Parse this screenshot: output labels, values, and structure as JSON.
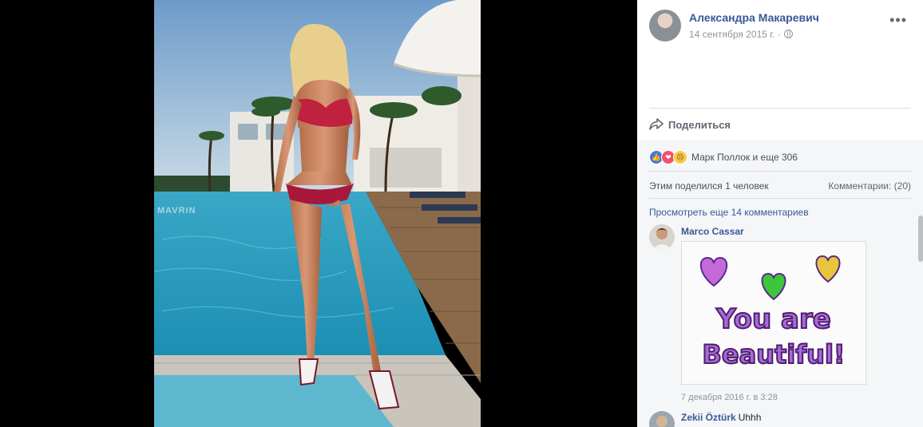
{
  "post": {
    "author": "Александра Макаревич",
    "date": "14 сентября 2015 г. ·",
    "menu_label": "•••"
  },
  "photo": {
    "watermark": "MAVRIN"
  },
  "actions": {
    "share_label": "Поделиться"
  },
  "reactions": {
    "summary": "Марк Поллок и еще 306",
    "icons": [
      "like-icon",
      "love-icon",
      "sad-icon"
    ]
  },
  "stats": {
    "shared_by": "Этим поделился 1 человек",
    "comments": "Комментарии: (20)"
  },
  "comments": {
    "view_more": "Просмотреть еще 14 комментариев",
    "items": [
      {
        "author": "Marco Cassar",
        "sticker_text_line1": "You are",
        "sticker_text_line2": "Beautiful!",
        "time": "7 декабря 2016 г. в 3:28"
      },
      {
        "author": "Zekii Öztürk",
        "text": "Uhhh"
      }
    ]
  },
  "colors": {
    "link": "#385898",
    "secondary_text": "#90949c",
    "like_blue": "#4a76d8",
    "love_red": "#f25268",
    "sad_yellow": "#f7cc4b"
  }
}
